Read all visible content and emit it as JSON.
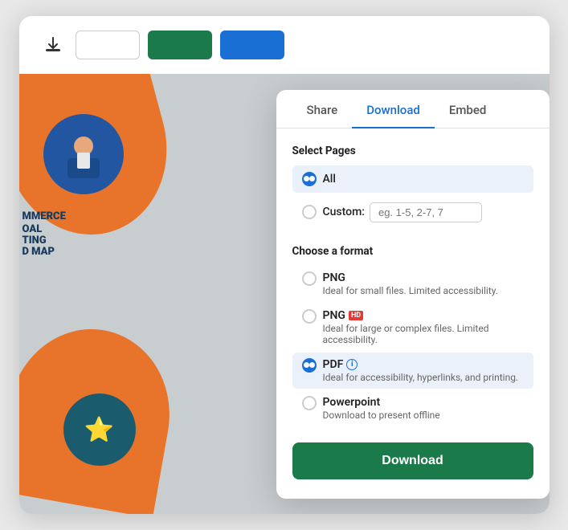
{
  "toolbar": {
    "download_icon": "⬇",
    "btn_gray_label": "",
    "btn_green_label": "",
    "btn_blue_label": ""
  },
  "tabs": [
    {
      "id": "share",
      "label": "Share",
      "active": false
    },
    {
      "id": "download",
      "label": "Download",
      "active": true
    },
    {
      "id": "embed",
      "label": "Embed",
      "active": false
    }
  ],
  "select_pages": {
    "label": "Select Pages",
    "options": [
      {
        "id": "all",
        "label": "All",
        "checked": true
      },
      {
        "id": "custom",
        "label": "Custom:",
        "checked": false
      }
    ],
    "custom_placeholder": "eg. 1-5, 2-7, 7"
  },
  "choose_format": {
    "label": "Choose a format",
    "formats": [
      {
        "id": "png",
        "name": "PNG",
        "badge": "",
        "desc": "Ideal for small files. Limited accessibility.",
        "checked": false,
        "has_info": false
      },
      {
        "id": "png_hd",
        "name": "PNG",
        "badge": "HD",
        "desc": "Ideal for large or complex files. Limited accessibility.",
        "checked": false,
        "has_info": false
      },
      {
        "id": "pdf",
        "name": "PDF",
        "badge": "",
        "desc": "Ideal for accessibility, hyperlinks, and printing.",
        "checked": true,
        "has_info": true
      },
      {
        "id": "powerpoint",
        "name": "Powerpoint",
        "badge": "",
        "desc": "Download to present offline",
        "checked": false,
        "has_info": false
      }
    ]
  },
  "download_button": {
    "label": "Download"
  },
  "colors": {
    "active_tab": "#1a6fd4",
    "selected_bg": "#eaf1fb",
    "download_btn_bg": "#1a7a4a",
    "radio_checked": "#1a6fd4"
  }
}
